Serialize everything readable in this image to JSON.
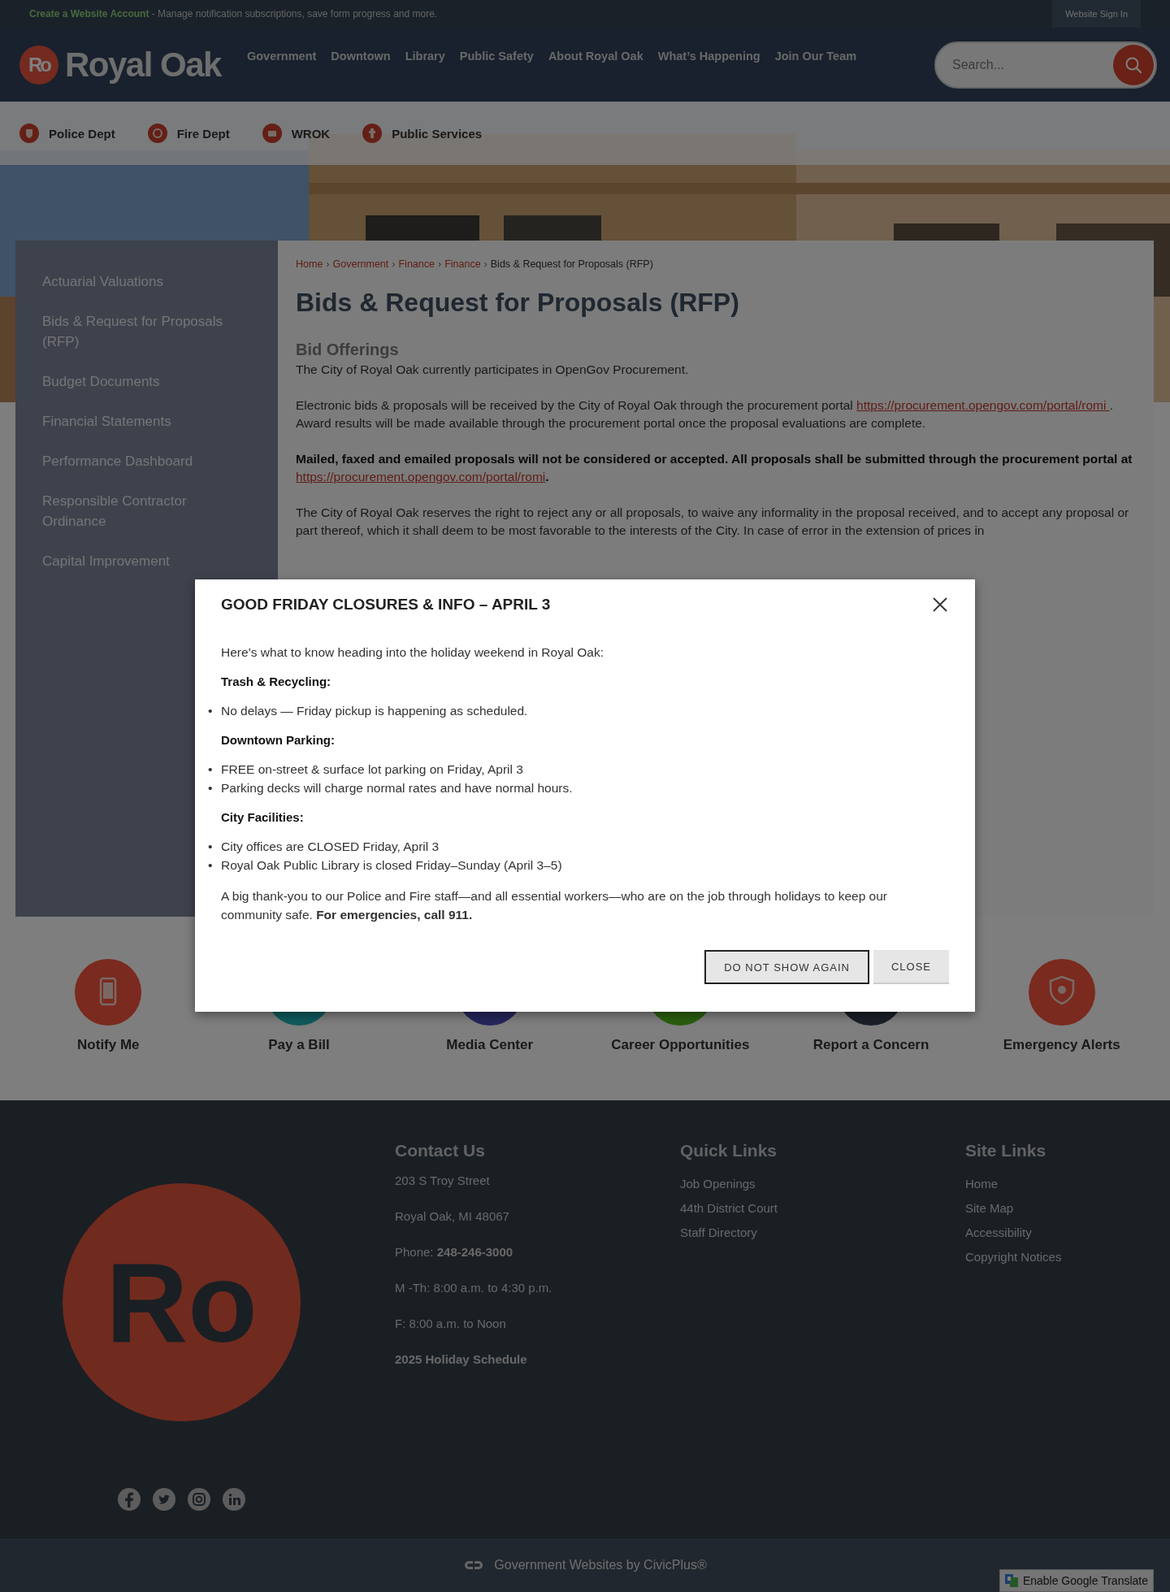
{
  "top_bar": {
    "account_link": "Create a Website Account",
    "account_text": "- Manage notification subscriptions, save form progress and more.",
    "sign_in": "Website Sign In"
  },
  "header": {
    "logo_mark": "Ro",
    "logo_text": "Royal Oak",
    "nav": [
      "Government",
      "Downtown",
      "Library",
      "Public Safety",
      "About Royal Oak",
      "What’s Happening",
      "Join Our Team"
    ],
    "search": {
      "placeholder": "Search..."
    }
  },
  "quick_nav": [
    {
      "label": "Police Dept"
    },
    {
      "label": "Fire Dept"
    },
    {
      "label": "WROK"
    },
    {
      "label": "Public Services"
    }
  ],
  "sidebar": {
    "items": [
      {
        "label": "Actuarial Valuations"
      },
      {
        "label": "Bids & Request for Proposals (RFP)"
      },
      {
        "label": "Budget Documents"
      },
      {
        "label": "Financial Statements"
      },
      {
        "label": "Performance Dashboard"
      },
      {
        "label": "Responsible Contractor Ordinance"
      },
      {
        "label": "Capital Improvement"
      }
    ]
  },
  "breadcrumb": [
    {
      "label": "Home",
      "current": false
    },
    {
      "separator": "›",
      "label": "Government",
      "current": false
    },
    {
      "separator": "›",
      "label": "Finance",
      "current": false
    },
    {
      "separator": "›",
      "label": "Finance",
      "current": false
    },
    {
      "separator": "›",
      "label": "Bids & Request for Proposals (RFP)",
      "current": true
    }
  ],
  "page_title": "Bids & Request for Proposals (RFP)",
  "section_heading": "Bid Offerings",
  "paragraphs": [
    {
      "bold": false,
      "segments": [
        {
          "kind": "text",
          "text": "The City of Royal Oak currently participates in OpenGov Procurement."
        }
      ]
    },
    {
      "bold": false,
      "segments": [
        {
          "kind": "text",
          "text": "Electronic bids & proposals will be received by the City of Royal Oak through the procurement portal "
        },
        {
          "kind": "link",
          "text": "https://procurement.opengov.com/portal/romi "
        },
        {
          "kind": "text",
          "text": ". Award results will be made available through the procurement portal once the proposal evaluations are complete."
        }
      ]
    },
    {
      "bold": true,
      "segments": [
        {
          "kind": "text",
          "text": "Mailed, faxed and emailed proposals will not be considered or accepted. All proposals shall be submitted through the procurement portal at "
        },
        {
          "kind": "link",
          "text": "https://procurement.opengov.com/portal/romi"
        },
        {
          "kind": "text",
          "text": "."
        }
      ]
    },
    {
      "bold": false,
      "segments": [
        {
          "kind": "text",
          "text": "The City of Royal Oak reserves the right to reject any or all proposals, to waive any informality in the proposal received, and to accept any proposal or part thereof, which it shall deem to be most favorable to the interests of the City. In case of error in the extension of prices in"
        }
      ]
    }
  ],
  "modal": {
    "title": "GOOD FRIDAY CLOSURES & INFO – APRIL 3",
    "intro": "Here’s what to know heading into the holiday weekend in Royal Oak:",
    "sections": [
      {
        "heading": "Trash & Recycling:",
        "bullets": [
          {
            "marker": "•",
            "text": "No delays — Friday pickup is happening as scheduled."
          }
        ]
      },
      {
        "heading": "Downtown Parking:",
        "bullets": [
          {
            "marker": "•",
            "text": "FREE on-street & surface lot parking on Friday, April 3"
          },
          {
            "marker": "•",
            "text": "Parking decks will charge normal rates and have normal hours."
          }
        ]
      },
      {
        "heading": "City Facilities:",
        "bullets": [
          {
            "marker": "•",
            "text": "City offices are CLOSED Friday, April 3"
          },
          {
            "marker": "•",
            "text": "Royal Oak Public Library is closed Friday–Sunday (April 3–5)"
          }
        ]
      }
    ],
    "closing": "A big thank-you to our Police and Fire staff—and all essential workers—who are on the job through holidays to keep our community safe. **For emergencies, call 911.**",
    "buttons": [
      {
        "label": "DO NOT SHOW AGAIN",
        "kind": "outline"
      },
      {
        "label": "CLOSE",
        "kind": "plain"
      }
    ]
  },
  "action_tiles": [
    {
      "label": "Notify Me",
      "color": "#7a2a1e",
      "kind": "phone"
    },
    {
      "label": "Pay a Bill",
      "color": "#105a5c"
    },
    {
      "label": "Media Center",
      "color": "#26265a"
    },
    {
      "label": "Career Opportunities",
      "color": "#2a5e0e"
    },
    {
      "label": "Report a Concern",
      "color": "#1a1f28"
    },
    {
      "label": "Emergency Alerts",
      "color": "#7a2a1e",
      "kind": "badge"
    }
  ],
  "footer": {
    "logo_mark": "Ro",
    "contact": {
      "heading": "Contact Us",
      "lines": [
        "203 S Troy Street",
        "Royal Oak, MI 48067",
        "Phone: **248-246-3000**",
        "M -Th:  8:00 a.m. to 4:30 p.m.",
        "F: 8:00 a.m. to Noon"
      ],
      "holiday_link": "2025 Holiday Schedule"
    },
    "quick_links": {
      "heading": "Quick Links",
      "links": [
        "Job Openings",
        "44th District Court",
        "Staff Directory"
      ]
    },
    "site_links": {
      "heading": "Site Links",
      "links": [
        "Home",
        "Site Map",
        "Accessibility",
        "Copyright Notices"
      ]
    }
  },
  "bottom_bar": {
    "credit": "Government Websites by CivicPlus®",
    "translate": "Enable Google Translate"
  }
}
